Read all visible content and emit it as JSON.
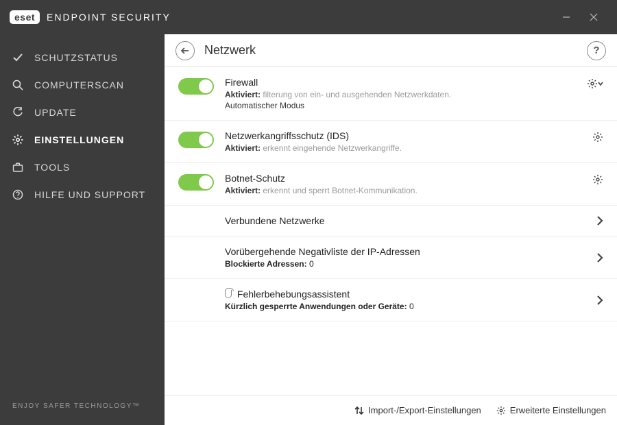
{
  "app": {
    "logo_badge": "eset",
    "product_name": "ENDPOINT SECURITY"
  },
  "sidebar": {
    "items": [
      {
        "icon": "check",
        "label": "SCHUTZSTATUS"
      },
      {
        "icon": "search",
        "label": "COMPUTERSCAN"
      },
      {
        "icon": "refresh",
        "label": "UPDATE"
      },
      {
        "icon": "gear",
        "label": "EINSTELLUNGEN"
      },
      {
        "icon": "briefcase",
        "label": "TOOLS"
      },
      {
        "icon": "help",
        "label": "HILFE UND SUPPORT"
      }
    ],
    "active_index": 3,
    "footer": "ENJOY SAFER TECHNOLOGY™"
  },
  "header": {
    "title": "Netzwerk",
    "help_char": "?"
  },
  "settings": [
    {
      "title": "Firewall",
      "status_label": "Aktiviert:",
      "desc": "filterung von ein- und ausgehenden Netzwerkdaten.",
      "mode": "Automatischer Modus",
      "toggle_on": true,
      "has_dropdown": true
    },
    {
      "title": "Netzwerkangriffsschutz (IDS)",
      "status_label": "Aktiviert:",
      "desc": "erkennt eingehende Netzwerkangriffe.",
      "mode": "",
      "toggle_on": true,
      "has_dropdown": false
    },
    {
      "title": "Botnet-Schutz",
      "status_label": "Aktiviert:",
      "desc": "erkennt und sperrt Botnet-Kommunikation.",
      "mode": "",
      "toggle_on": true,
      "has_dropdown": false
    }
  ],
  "navrows": [
    {
      "title": "Verbundene Netzwerke",
      "sub_bold": "",
      "sub_value": "",
      "has_shield": false
    },
    {
      "title": "Vorübergehende Negativliste der IP-Adressen",
      "sub_bold": "Blockierte Adressen:",
      "sub_value": " 0",
      "has_shield": false
    },
    {
      "title": "Fehlerbehebungsassistent",
      "sub_bold": "Kürzlich gesperrte Anwendungen oder Geräte:",
      "sub_value": " 0",
      "has_shield": true
    }
  ],
  "footer": {
    "import_export": "Import-/Export-Einstellungen",
    "advanced": "Erweiterte Einstellungen"
  }
}
